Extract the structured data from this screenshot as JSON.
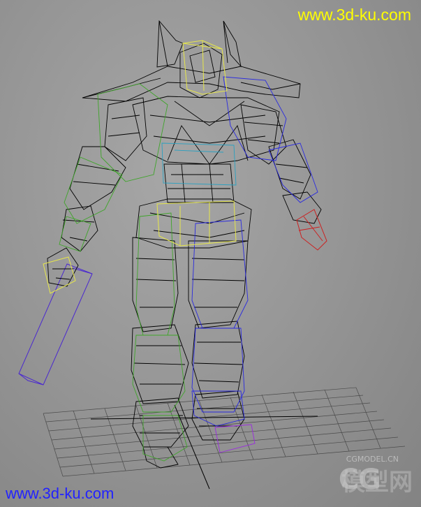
{
  "watermark": {
    "top": "www.3d-ku.com",
    "bottom": "www.3d-ku.com",
    "logo_cg": "CG",
    "logo_cn": "模型网",
    "logo_url": "CGMODEL.CN"
  },
  "colors": {
    "background": "#979797",
    "grid": "#4a4a4a",
    "mesh": "#000000",
    "green_bones": "#3fa52a",
    "blue_bones": "#2a2ae0",
    "cyan_bones": "#2aa0c0",
    "yellow_bones": "#e6e64a",
    "red_hand": "#cc2020",
    "sword": "#4a28d0",
    "watermark_top": "#ffff00",
    "watermark_bottom": "#2222ff"
  }
}
